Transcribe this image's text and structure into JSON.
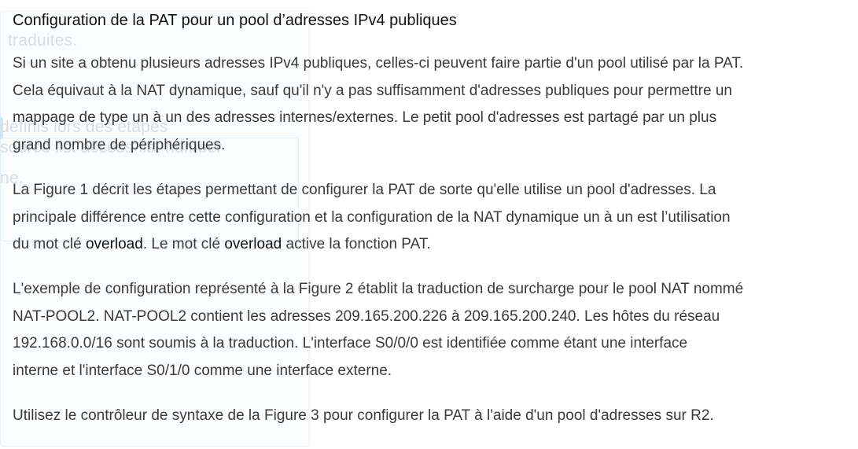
{
  "ghost": {
    "lines": [
      "",
      "traduites.",
      "",
      "",
      "",
      "définis lors des étapes",
      "source list access-list-number",
      "",
      "ne."
    ]
  },
  "article": {
    "title": "Configuration de la PAT pour un pool d’adresses IPv4 publiques",
    "p1": [
      "Si un site a obtenu plusieurs adresses IPv4 publiques, celles-ci peuvent faire partie d'un pool utilisé par la PAT.",
      "Cela équivaut à la NAT dynamique, sauf qu'il n'y a pas suffisamment d'adresses publiques pour permettre un",
      "mappage de type un à un des adresses internes/externes. Le petit pool d'adresses est partagé par un plus",
      "grand nombre de périphériques."
    ],
    "p2": {
      "line1": "La Figure 1 décrit les étapes permettant de configurer la PAT de sorte qu'elle utilise un pool d'adresses. La",
      "line2": "principale différence entre cette configuration et la configuration de la NAT dynamique un à un est l’utilisation",
      "line3_a": "du mot clé ",
      "keyword1": "overload",
      "line3_b": ". Le mot clé ",
      "keyword2": "overload",
      "line3_c": " active la fonction PAT."
    },
    "p3": [
      "L'exemple de configuration représenté à la Figure 2 établit la traduction de surcharge pour le pool NAT nommé",
      "NAT-POOL2. NAT-POOL2 contient les adresses 209.165.200.226 à 209.165.200.240. Les hôtes du réseau",
      "192.168.0.0/16 sont soumis à la traduction. L'interface S0/0/0 est identifiée comme étant une interface",
      "interne et l'interface S0/1/0 comme une interface externe."
    ],
    "p4": "Utilisez le contrôleur de syntaxe de la Figure 3 pour configurer la PAT à l'aide d'un pool d'adresses sur R2."
  }
}
